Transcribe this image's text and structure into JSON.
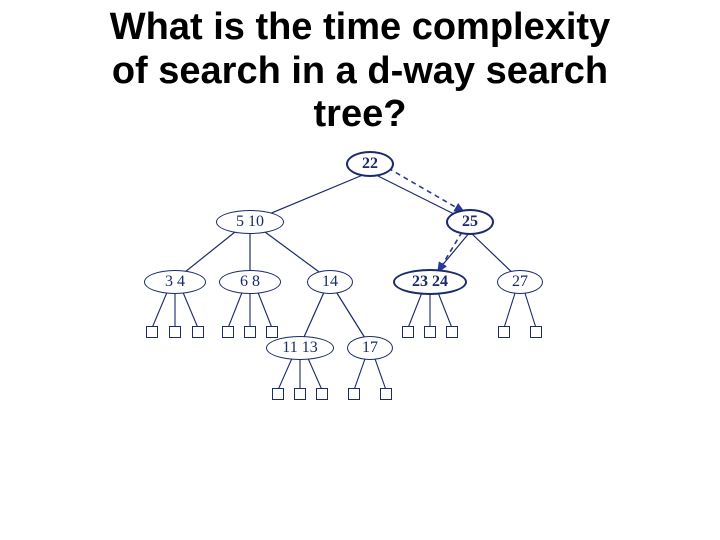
{
  "title_line1": "What is the time complexity",
  "title_line2": "of search in a d-way search",
  "title_line3": "tree?",
  "tree": {
    "root": "22",
    "n5_10": "5  10",
    "n25": "25",
    "n3_4": "3  4",
    "n6_8": "6  8",
    "n14": "14",
    "n23_24": "23  24",
    "n27": "27",
    "n11_13": "11  13",
    "n17": "17"
  }
}
